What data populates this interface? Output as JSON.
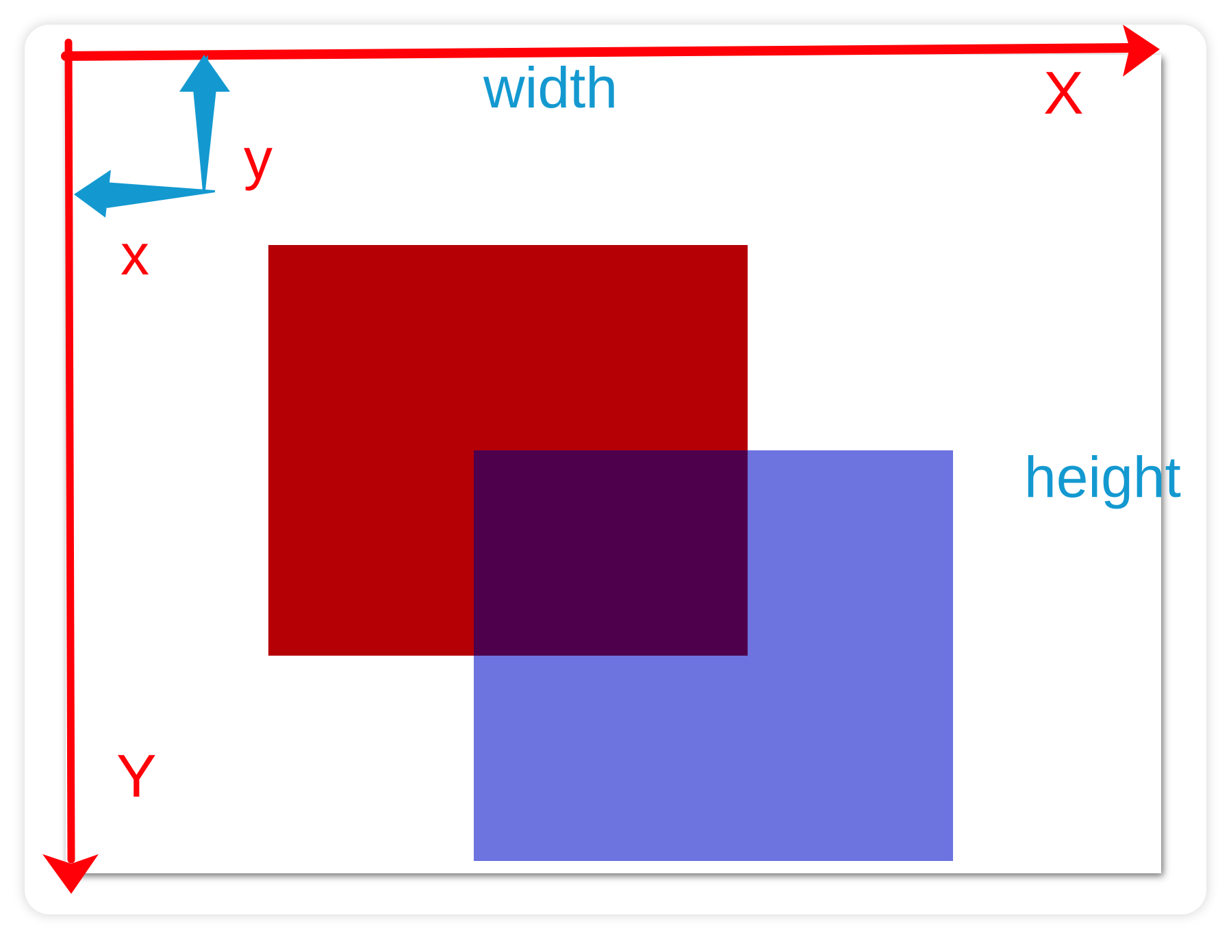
{
  "colors": {
    "axis_red": "#ff0008",
    "measure_blue": "#1399d0",
    "rect_red": "#b50006",
    "rect_blue": "#6d73df",
    "overlap": "#4e004c"
  },
  "labels": {
    "width": "width",
    "height": "height",
    "axis_x": "X",
    "axis_y": "Y",
    "offset_x": "x",
    "offset_y": "y"
  },
  "icons": {
    "x_axis_arrow": "arrow-right",
    "y_axis_arrow": "arrow-down",
    "offset_x_arrow": "arrow-left",
    "offset_y_arrow": "arrow-up"
  }
}
